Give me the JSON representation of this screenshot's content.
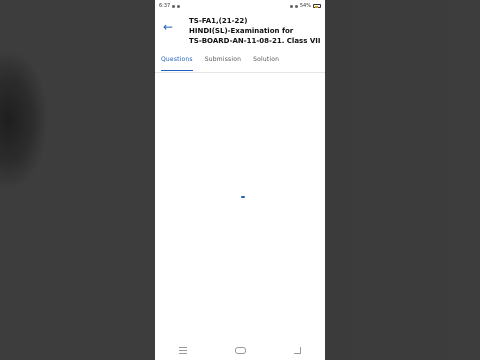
{
  "status": {
    "time": "6:37",
    "battery": "54%"
  },
  "header": {
    "back_icon": "arrow-left-icon",
    "title_line1": "TS-FA1,(21-22)",
    "title_line2": "HINDI(SL)-Examination for",
    "title_line3": "TS-BOARD-AN-11-08-21. Class VII"
  },
  "tabs": [
    {
      "label": "Questions",
      "active": true
    },
    {
      "label": "Submission",
      "active": false
    },
    {
      "label": "Solution",
      "active": false
    }
  ],
  "colors": {
    "accent": "#1f5fbf"
  }
}
